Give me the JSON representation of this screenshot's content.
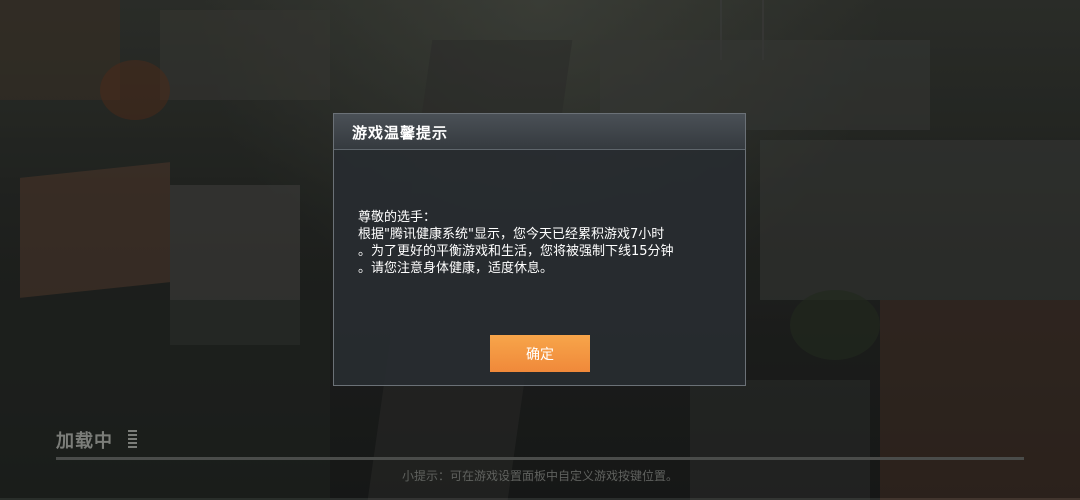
{
  "dialog": {
    "title": "游戏温馨提示",
    "body_lines": [
      "尊敬的选手：",
      "根据\"腾讯健康系统\"显示，您今天已经累积游戏7小时",
      "。为了更好的平衡游戏和生活，您将被强制下线15分钟",
      "。请您注意身体健康，适度休息。"
    ],
    "confirm_label": "确定"
  },
  "loading": {
    "label": "加载中",
    "tip": "小提示：可在游戏设置面板中自定义游戏按键位置。"
  },
  "colors": {
    "accent": "#f29a3f",
    "dialog_bg": "#2a2e33",
    "dialog_border": "#6b7177"
  }
}
